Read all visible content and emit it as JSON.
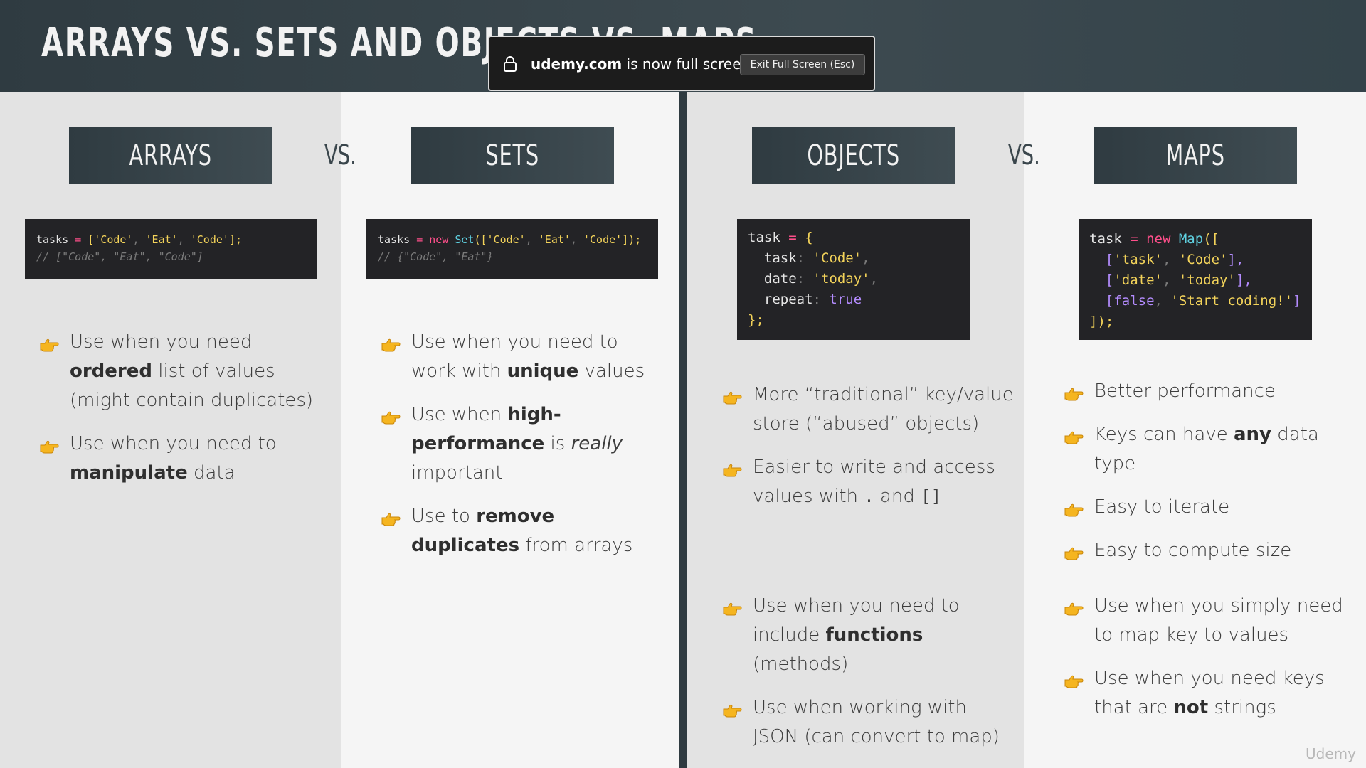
{
  "slide": {
    "title": "ARRAYS VS. SETS AND OBJECTS VS. MAPS"
  },
  "fullscreen_notice": {
    "domain": "udemy.com",
    "message": " is now full screen",
    "exit_button": "Exit Full Screen (Esc)"
  },
  "columns": {
    "arrays": {
      "label": "ARRAYS",
      "code": {
        "line1": {
          "a": "tasks ",
          "op": "= ",
          "p1": "[",
          "s1": "'Code'",
          "c1": ", ",
          "s2": "'Eat'",
          "c2": ", ",
          "s3": "'Code'",
          "end": "];"
        },
        "line2": "// [\"Code\", \"Eat\", \"Code\"]"
      },
      "bullets": [
        {
          "pre": "Use when you need ",
          "bold": "ordered",
          "post": " list of values (might contain duplicates)"
        },
        {
          "pre": "Use when you need to ",
          "bold": "manipulate",
          "post": " data"
        }
      ]
    },
    "vs_left": "VS.",
    "sets": {
      "label": "SETS",
      "code": {
        "line1": {
          "a": "tasks ",
          "op": "= ",
          "kw": "new ",
          "fn": "Set",
          "p1": "([",
          "s1": "'Code'",
          "c1": ", ",
          "s2": "'Eat'",
          "c2": ", ",
          "s3": "'Code'",
          "end": "]);"
        },
        "line2": "// {\"Code\", \"Eat\"}"
      },
      "bullets": [
        {
          "pre": "Use when you need to work with ",
          "bold": "unique",
          "post": " values"
        },
        {
          "pre": "Use when ",
          "bold": "high-performance",
          "post": " is ",
          "italic": "really",
          "post2": " important"
        },
        {
          "pre": "Use to ",
          "bold": "remove duplicates",
          "post": " from arrays"
        }
      ]
    },
    "objects": {
      "label": "OBJECTS",
      "code": {
        "l1a": "task ",
        "l1op": "= ",
        "l1b": "{",
        "l2k": "  task",
        "l2c": ": ",
        "l2v": "'Code'",
        "l2e": ",",
        "l3k": "  date",
        "l3c": ": ",
        "l3v": "'today'",
        "l3e": ",",
        "l4k": "  repeat",
        "l4c": ": ",
        "l4v": "true",
        "l5": "};"
      },
      "bullets_top": [
        {
          "pre": "More “traditional” key/value store (“abused” objects)"
        },
        {
          "pre": "Easier to write and access values with ",
          "code1": ".",
          "mid": " and ",
          "code2": "[]"
        }
      ],
      "bullets_bottom": [
        {
          "pre": "Use when you need to include ",
          "bold": "functions",
          "post": " (methods)"
        },
        {
          "pre": "Use when working with JSON (can convert to map)"
        }
      ]
    },
    "vs_right": "VS.",
    "maps": {
      "label": "MAPS",
      "code": {
        "l1a": "task ",
        "l1op": "= ",
        "l1kw": "new ",
        "l1fn": "Map",
        "l1p": "([",
        "l2p": "  [",
        "l2s1": "'task'",
        "l2c": ", ",
        "l2s2": "'Code'",
        "l2e": "],",
        "l3p": "  [",
        "l3s1": "'date'",
        "l3c": ", ",
        "l3s2": "'today'",
        "l3e": "],",
        "l4p": "  [",
        "l4b": "false",
        "l4c": ", ",
        "l4s": "'Start coding!'",
        "l4e": "]",
        "l5": "]);"
      },
      "bullets_top": [
        {
          "pre": "Better performance"
        },
        {
          "pre": "Keys can have ",
          "bold": "any",
          "post": " data type"
        },
        {
          "pre": "Easy to iterate"
        },
        {
          "pre": "Easy to compute size"
        }
      ],
      "bullets_bottom": [
        {
          "pre": "Use when you simply need to map key to values"
        },
        {
          "pre": "Use when you need keys that are ",
          "bold": "not",
          "post": " strings"
        }
      ]
    }
  },
  "watermark": "Udemy",
  "colors": {
    "header": "#2f3b41",
    "keyword": "#ff4f8b",
    "string": "#f3d35a",
    "function": "#5fd0e0",
    "boolean": "#b48cff",
    "hand_icon": "#f5b520"
  }
}
